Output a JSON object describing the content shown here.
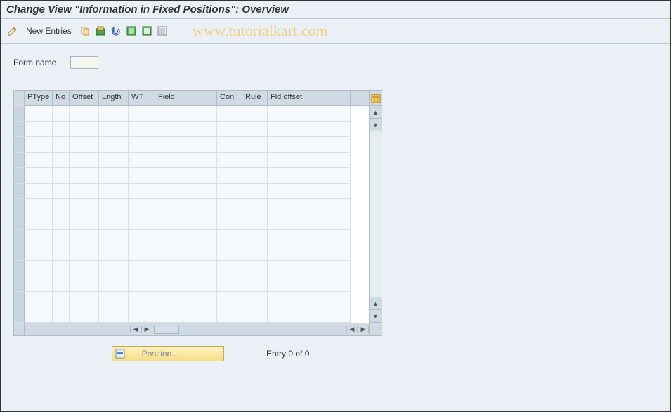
{
  "title": "Change View \"Information in Fixed Positions\": Overview",
  "toolbar": {
    "new_entries_label": "New Entries"
  },
  "watermark": "www.tutorialkart.com",
  "form": {
    "form_name_label": "Form name",
    "form_name_value": ""
  },
  "grid": {
    "columns": {
      "ptype": "PType",
      "no": "No",
      "offset": "Offset",
      "lngth": "Lngth",
      "wt": "WT",
      "field": "Field",
      "con": "Con.",
      "rule": "Rule",
      "fld_offset": "Fld offset"
    },
    "row_count": 14
  },
  "footer": {
    "position_label": "Position...",
    "entry_text": "Entry 0 of 0"
  }
}
